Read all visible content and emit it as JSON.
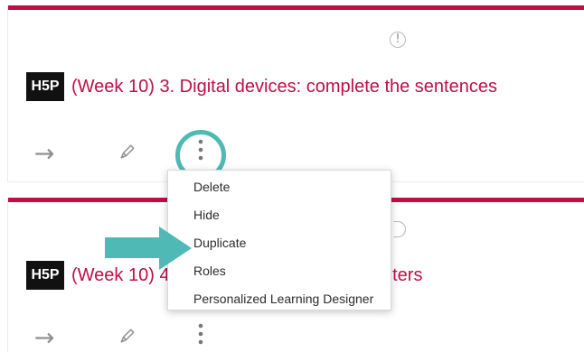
{
  "cards": [
    {
      "title": "(Week 10) 3. Digital devices: complete the sentences",
      "logo_text": "H5P",
      "info_symbol": "!",
      "actions": {
        "forward_icon": "arrow-right-icon",
        "edit_icon": "pencil-icon",
        "menu_icon": "kebab-menu-icon"
      }
    },
    {
      "title_visible_start": "(Week 10) 4",
      "title_visible_end": "uters",
      "logo_text": "H5P",
      "actions": {
        "forward_icon": "arrow-right-icon",
        "edit_icon": "pencil-icon",
        "menu_icon": "kebab-menu-icon"
      }
    }
  ],
  "menu": {
    "items": [
      {
        "label": "Delete"
      },
      {
        "label": "Hide"
      },
      {
        "label": "Duplicate"
      },
      {
        "label": "Roles"
      },
      {
        "label": "Personalized Learning Designer"
      }
    ]
  },
  "colors": {
    "accent": "#be0f45",
    "highlight": "#4fb9b5",
    "icon_gray": "#8f8f8f",
    "logo_background": "#111111"
  }
}
